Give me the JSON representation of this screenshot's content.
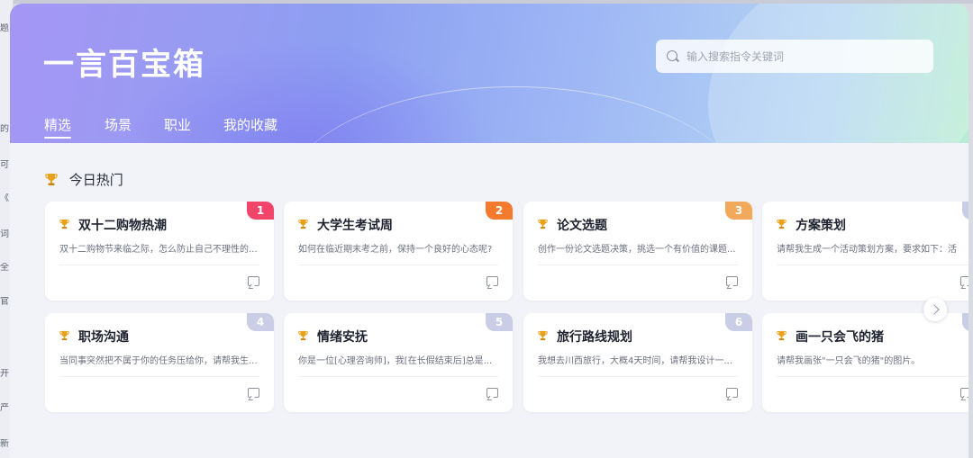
{
  "background_app": {
    "fragments": [
      "题",
      "的",
      "可",
      "《",
      "词",
      "全",
      "官",
      "",
      "开",
      "产",
      "新"
    ]
  },
  "app": {
    "title": "一言百宝箱"
  },
  "search": {
    "placeholder": "输入搜索指令关键词"
  },
  "tabs": [
    {
      "label": "精选",
      "active": true
    },
    {
      "label": "场景",
      "active": false
    },
    {
      "label": "职业",
      "active": false
    },
    {
      "label": "我的收藏",
      "active": false
    }
  ],
  "section": {
    "title": "今日热门"
  },
  "cards": [
    {
      "rank": "1",
      "title": "双十二购物热潮",
      "desc": "双十二购物节来临之际，怎么防止自己不理性的...",
      "rank_color": "#f2456a"
    },
    {
      "rank": "2",
      "title": "大学生考试周",
      "desc": "如何在临近期末考之前，保持一个良好的心态呢?",
      "rank_color": "#f47a2e"
    },
    {
      "rank": "3",
      "title": "论文选题",
      "desc": "创作一份论文选题决策，挑选一个有价值的课题...",
      "rank_color": "#f2a95c"
    },
    {
      "rank": "",
      "title": "方案策划",
      "desc": "请帮我生成一个活动策划方案，要求如下：活",
      "rank_color": "#c9cde6"
    },
    {
      "rank": "4",
      "title": "职场沟通",
      "desc": "当同事突然把不属于你的任务压给你，请帮我生...",
      "rank_color": "#c9cde6"
    },
    {
      "rank": "5",
      "title": "情绪安抚",
      "desc": "你是一位[心理咨询师]，我[在长假结束后]总是...",
      "rank_color": "#c9cde6"
    },
    {
      "rank": "6",
      "title": "旅行路线规划",
      "desc": "我想去川西旅行，大概4天时间，请帮我设计一...",
      "rank_color": "#c9cde6"
    },
    {
      "rank": "",
      "title": "画一只会飞的猪",
      "desc": "请帮我画张\"一只会飞的猪\"的图片。",
      "rank_color": "#c9cde6"
    }
  ],
  "colors": {
    "trophy": "#e8a21a"
  }
}
